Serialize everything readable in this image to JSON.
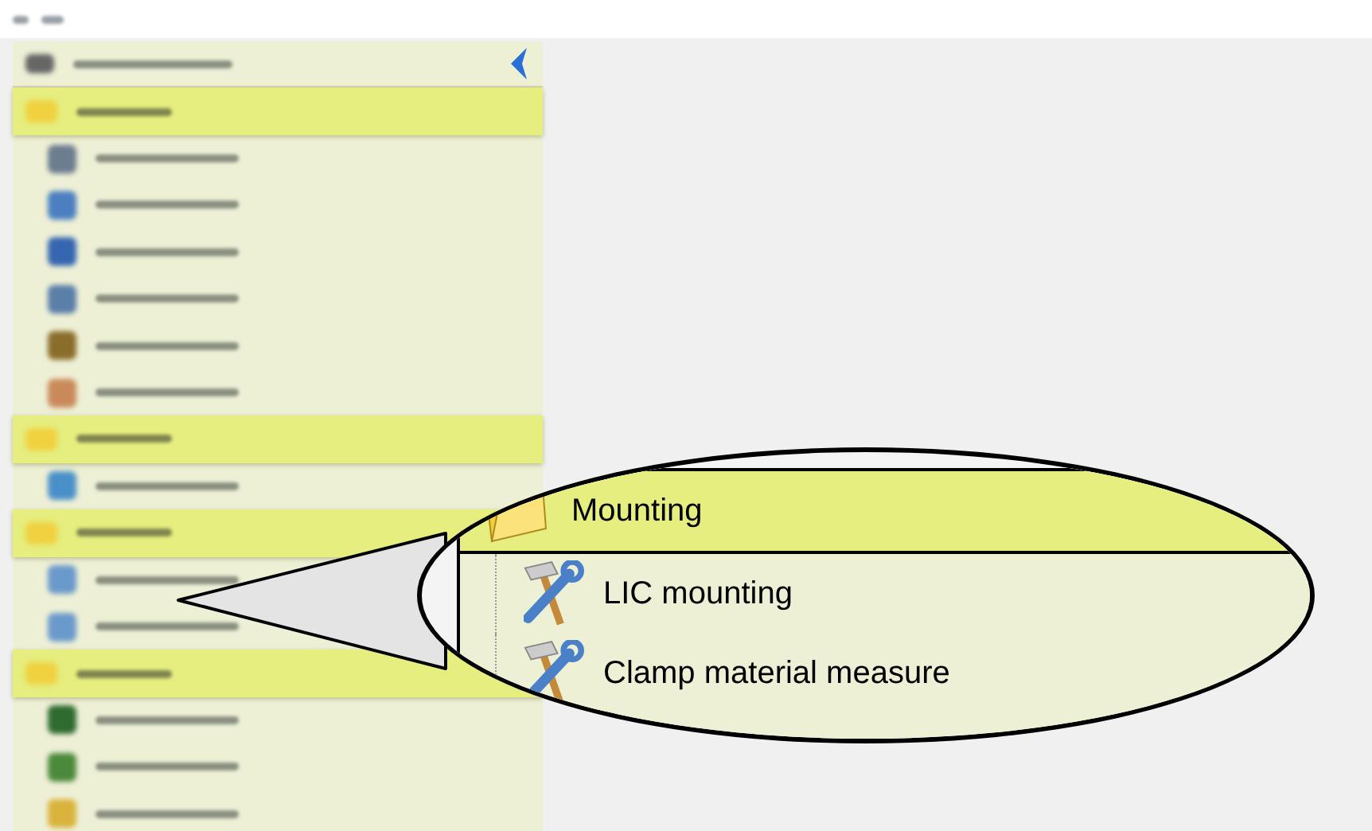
{
  "sidebar": {
    "rows": [
      {
        "kind": "header"
      },
      {
        "kind": "group"
      },
      {
        "kind": "item"
      },
      {
        "kind": "item"
      },
      {
        "kind": "item"
      },
      {
        "kind": "item"
      },
      {
        "kind": "item"
      },
      {
        "kind": "item"
      },
      {
        "kind": "group"
      },
      {
        "kind": "item"
      },
      {
        "kind": "group"
      },
      {
        "kind": "item"
      },
      {
        "kind": "item"
      },
      {
        "kind": "group"
      },
      {
        "kind": "item"
      },
      {
        "kind": "item"
      },
      {
        "kind": "item"
      }
    ]
  },
  "magnifier": {
    "group": "Mounting",
    "items": [
      "LIC mounting",
      "Clamp material measure"
    ]
  }
}
